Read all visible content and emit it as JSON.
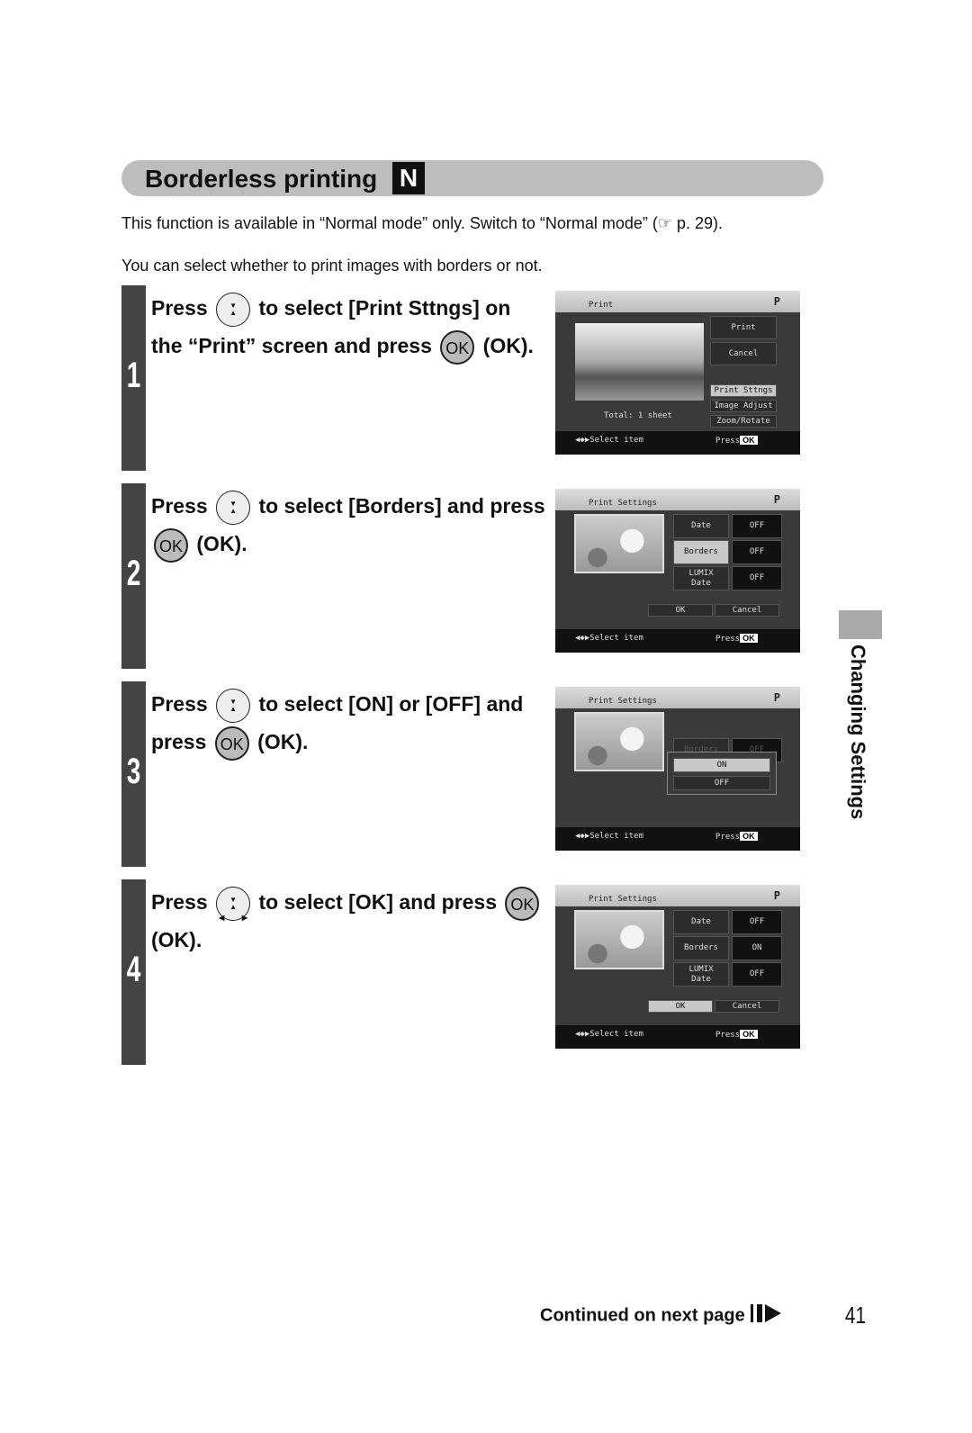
{
  "title": "Borderless printing",
  "mode_badge": "N",
  "intro": [
    "This function is available in “Normal mode” only. Switch to “Normal mode” (☞ p. 29).",
    "You can select whether to print images with borders or not."
  ],
  "steps": [
    {
      "num": "1",
      "parts": [
        "Press ",
        {
          "icon": "dpad"
        },
        " to select [Print Sttngs] on the “Print” screen and press ",
        {
          "icon": "ok"
        },
        " (OK)."
      ]
    },
    {
      "num": "2",
      "parts": [
        "Press ",
        {
          "icon": "dpad"
        },
        " to select [Borders] and press ",
        {
          "icon": "ok"
        },
        " (OK)."
      ]
    },
    {
      "num": "3",
      "parts": [
        "Press ",
        {
          "icon": "dpad"
        },
        " to select [ON] or [OFF] and press ",
        {
          "icon": "ok"
        },
        " (OK)."
      ]
    },
    {
      "num": "4",
      "parts": [
        "Press ",
        {
          "icon": "dpad4"
        },
        " to select [OK] and press ",
        {
          "icon": "ok"
        },
        " (OK)."
      ]
    }
  ],
  "ok_icon_label": "OK",
  "screens": [
    {
      "title": "Print",
      "menu": [
        "Print",
        "Cancel",
        "Print Sttngs",
        "Image Adjust",
        "Zoom/Rotate"
      ],
      "selected": "Print Sttngs",
      "total": "Total:   1 sheet"
    },
    {
      "title": "Print Settings",
      "rows": [
        [
          "Date",
          "OFF"
        ],
        [
          "Borders",
          "OFF"
        ],
        [
          "LUMIX Date",
          "OFF"
        ]
      ],
      "selected": "Borders",
      "buttons": [
        "OK",
        "Cancel"
      ]
    },
    {
      "title": "Print Settings",
      "behind": [
        "Borders",
        "OFF"
      ],
      "options": [
        "ON",
        "OFF"
      ],
      "selected": "ON"
    },
    {
      "title": "Print Settings",
      "rows": [
        [
          "Date",
          "OFF"
        ],
        [
          "Borders",
          "ON"
        ],
        [
          "LUMIX Date",
          "OFF"
        ]
      ],
      "selected": "OK",
      "buttons": [
        "OK",
        "Cancel"
      ]
    }
  ],
  "screen_common": {
    "printer_icon": "P",
    "select_hint": "◀◆▶Select item",
    "press": "Press",
    "ok": "OK"
  },
  "side_tab": "Changing Settings",
  "continued": "Continued on next page",
  "page_number": "41"
}
